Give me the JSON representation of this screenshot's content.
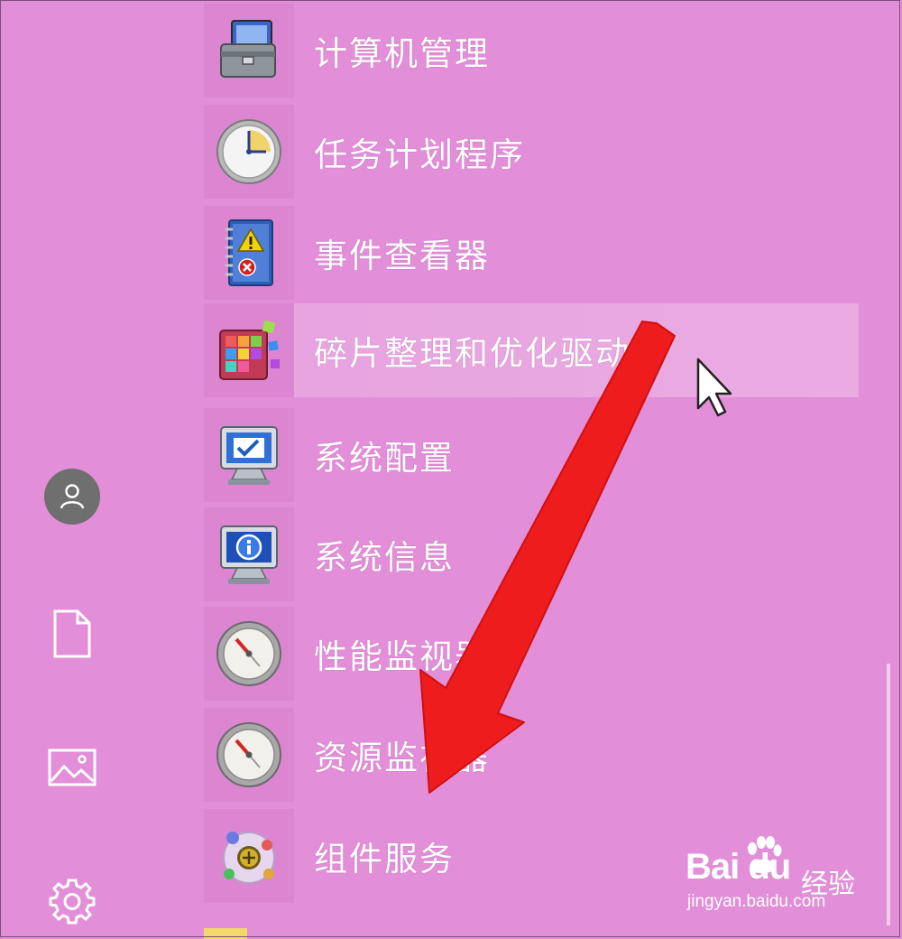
{
  "window": {
    "background": "#e28ed8",
    "tile_color": "#dc86d2"
  },
  "left_rail": [
    {
      "name": "user-account",
      "icon": "user-icon"
    },
    {
      "name": "documents",
      "icon": "document-icon"
    },
    {
      "name": "pictures",
      "icon": "picture-icon"
    },
    {
      "name": "settings",
      "icon": "gear-icon"
    }
  ],
  "apps": [
    {
      "label": "计算机管理",
      "icon": "computer-management-icon"
    },
    {
      "label": "任务计划程序",
      "icon": "task-scheduler-clock-icon"
    },
    {
      "label": "事件查看器",
      "icon": "event-viewer-icon"
    },
    {
      "label": "碎片整理和优化驱动器",
      "icon": "defragment-icon",
      "hovered": true
    },
    {
      "label": "系统配置",
      "icon": "system-configuration-icon"
    },
    {
      "label": "系统信息",
      "icon": "system-information-icon"
    },
    {
      "label": "性能监视器",
      "icon": "performance-monitor-icon"
    },
    {
      "label": "资源监视器",
      "icon": "resource-monitor-icon"
    },
    {
      "label": "组件服务",
      "icon": "component-services-icon"
    }
  ],
  "annotation": {
    "arrow_color": "#ee1c1c"
  },
  "watermark": {
    "logo": "Bai  du",
    "chinese": "经验",
    "url": "jingyan.baidu.com"
  }
}
